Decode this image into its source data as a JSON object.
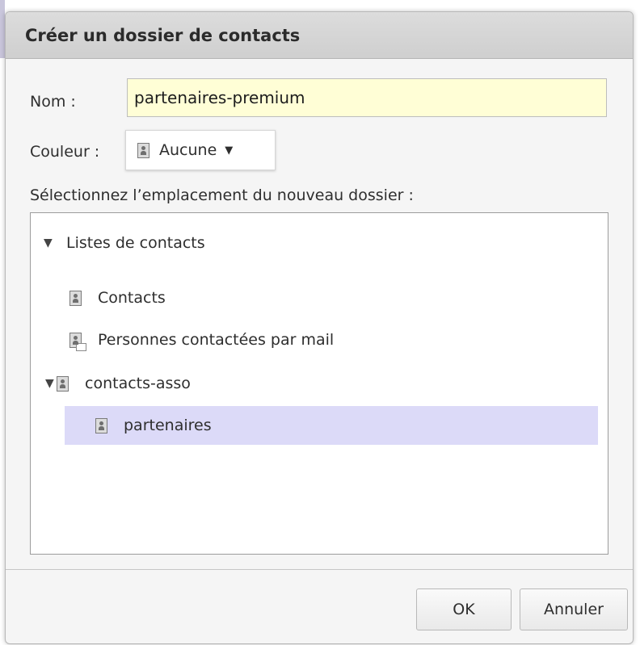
{
  "dialog": {
    "title": "Créer un dossier de contacts",
    "name_label": "Nom :",
    "name_value": "partenaires-premium",
    "color_label": "Couleur :",
    "color_value": "Aucune",
    "location_label": "Sélectionnez l’emplacement du nouveau dossier :",
    "tree": {
      "root_label": "Listes de contacts",
      "items": [
        {
          "label": "Contacts",
          "icon": "address-book-icon"
        },
        {
          "label": "Personnes contactées par mail",
          "icon": "address-book-mail-icon"
        },
        {
          "label": "contacts-asso",
          "icon": "address-book-icon"
        },
        {
          "label": "partenaires",
          "icon": "address-book-icon",
          "selected": true
        }
      ]
    },
    "buttons": {
      "ok": "OK",
      "cancel": "Annuler"
    }
  },
  "colors": {
    "input_background": "#fffed6",
    "selection": "#dcdaf8",
    "title_bar": "#d4d4d4"
  }
}
